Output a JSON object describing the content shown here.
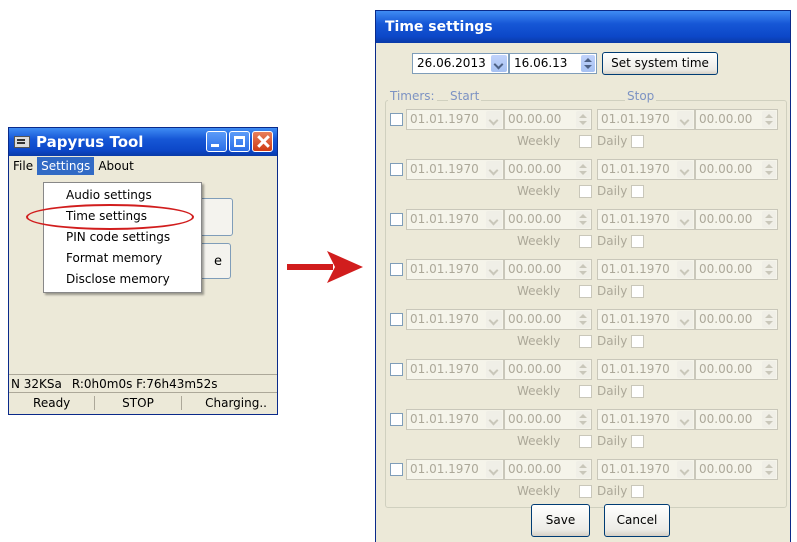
{
  "papyrus": {
    "title": "Papyrus Tool",
    "menu": {
      "file": "File",
      "settings": "Settings",
      "about": "About"
    },
    "dropdown": [
      "Audio settings",
      "Time settings",
      "PIN code settings",
      "Format memory",
      "Disclose memory"
    ],
    "button_partial_label": "e",
    "status_row1": {
      "mode": "N 32KSa",
      "times": "R:0h0m0s F:76h43m52s"
    },
    "status_row2": {
      "state": "Ready",
      "action": "STOP",
      "power": "Charging.."
    }
  },
  "time_settings": {
    "title": "Time settings",
    "date": "26.06.2013",
    "time": "16.06.13",
    "set_system_time": "Set system time",
    "timers_label": "Timers:",
    "start_label": "Start",
    "stop_label": "Stop",
    "weekly_label": "Weekly",
    "daily_label": "Daily",
    "timers": [
      {
        "start_date": "01.01.1970",
        "start_time": "00.00.00",
        "stop_date": "01.01.1970",
        "stop_time": "00.00.00"
      },
      {
        "start_date": "01.01.1970",
        "start_time": "00.00.00",
        "stop_date": "01.01.1970",
        "stop_time": "00.00.00"
      },
      {
        "start_date": "01.01.1970",
        "start_time": "00.00.00",
        "stop_date": "01.01.1970",
        "stop_time": "00.00.00"
      },
      {
        "start_date": "01.01.1970",
        "start_time": "00.00.00",
        "stop_date": "01.01.1970",
        "stop_time": "00.00.00"
      },
      {
        "start_date": "01.01.1970",
        "start_time": "00.00.00",
        "stop_date": "01.01.1970",
        "stop_time": "00.00.00"
      },
      {
        "start_date": "01.01.1970",
        "start_time": "00.00.00",
        "stop_date": "01.01.1970",
        "stop_time": "00.00.00"
      },
      {
        "start_date": "01.01.1970",
        "start_time": "00.00.00",
        "stop_date": "01.01.1970",
        "stop_time": "00.00.00"
      },
      {
        "start_date": "01.01.1970",
        "start_time": "00.00.00",
        "stop_date": "01.01.1970",
        "stop_time": "00.00.00"
      }
    ],
    "save": "Save",
    "cancel": "Cancel"
  },
  "colors": {
    "titlebar": "#0c47c8",
    "highlight": "#d11d1d",
    "arrow": "#d11d1d"
  }
}
